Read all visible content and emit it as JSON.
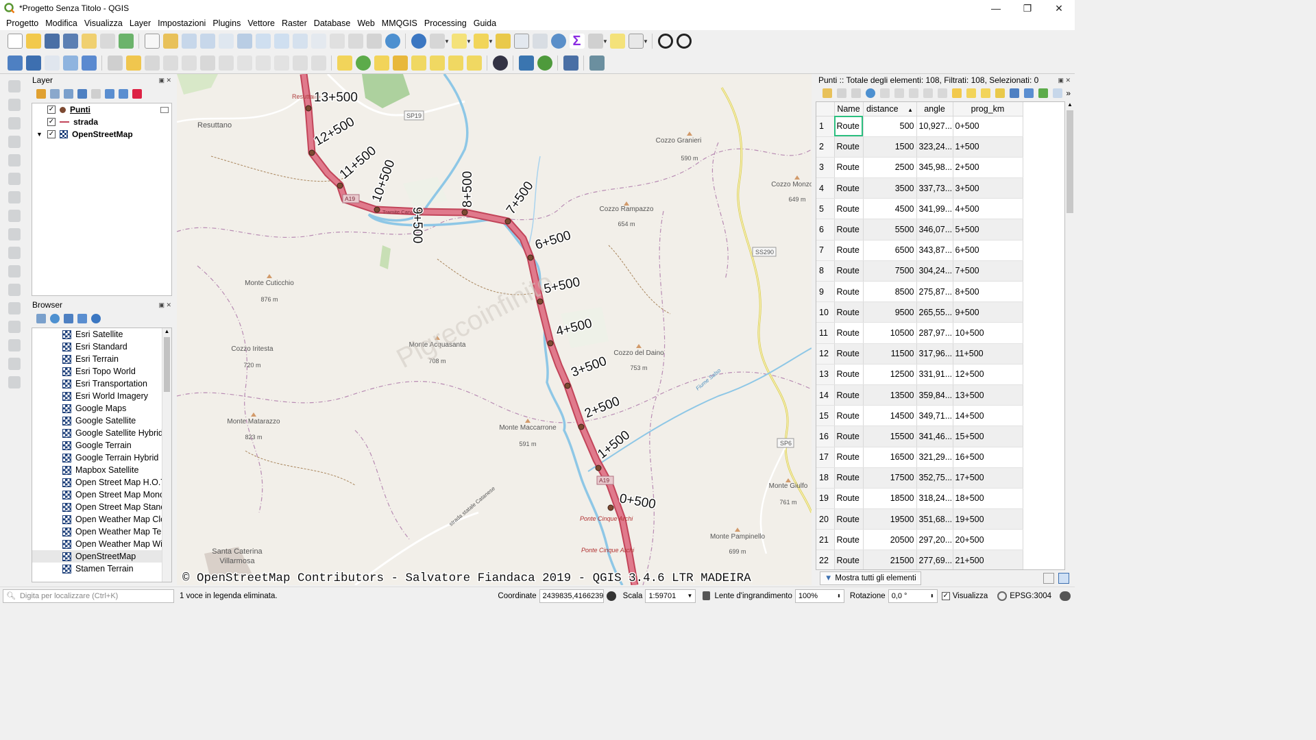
{
  "window": {
    "title": "*Progetto Senza Titolo - QGIS",
    "controls": [
      "—",
      "❐",
      "✕"
    ]
  },
  "menu": [
    "Progetto",
    "Modifica",
    "Visualizza",
    "Layer",
    "Impostazioni",
    "Plugins",
    "Vettore",
    "Raster",
    "Database",
    "Web",
    "MMQGIS",
    "Processing",
    "Guida"
  ],
  "layers_panel": {
    "title": "Layer",
    "items": [
      {
        "name": "Punti",
        "checked": "✓"
      },
      {
        "name": "strada",
        "checked": "✓"
      },
      {
        "name": "OpenStreetMap",
        "checked": "✓"
      }
    ]
  },
  "browser_panel": {
    "title": "Browser",
    "items": [
      "Esri Satellite",
      "Esri Standard",
      "Esri Terrain",
      "Esri Topo World",
      "Esri Transportation",
      "Esri World Imagery",
      "Google Maps",
      "Google Satellite",
      "Google Satellite Hybrid",
      "Google Terrain",
      "Google Terrain Hybrid",
      "Mapbox Satellite",
      "Open Street Map H.O.T.",
      "Open Street Map Mono",
      "Open Street Map Stand",
      "Open Weather Map Clo",
      "Open Weather Map Ten",
      "Open Weather Map Wir",
      "OpenStreetMap",
      "Stamen Terrain"
    ],
    "selected": "OpenStreetMap"
  },
  "map": {
    "attribution": "© OpenStreetMap Contributors - Salvatore Fiandaca 2019 - QGIS 3.4.6 LTR MADEIRA",
    "watermark": "Pigrecoinfinito",
    "chainage_labels": [
      "13+500",
      "12+500",
      "11+500",
      "10+500",
      "9+500",
      "8+500",
      "7+500",
      "6+500",
      "5+500",
      "4+500",
      "3+500",
      "2+500",
      "1+500",
      "0+500"
    ],
    "place_labels": [
      "Resuttano",
      "Resuttano",
      "SP19",
      "Cozzo Granieri",
      "590 m",
      "Cozzo Monzonar",
      "649 m",
      "Cozzo Rampazzo",
      "654 m",
      "SS290",
      "Monte Cuticchio",
      "876 m",
      "Monte Acquasanta",
      "708 m",
      "Cozzo Iritesta",
      "720 m",
      "Cozzo del Daino",
      "753 m",
      "Monte Matarazzo",
      "823 m",
      "Monte Maccarrone",
      "591 m",
      "SP6",
      "Monte Giulfo",
      "761 m",
      "A19",
      "A19",
      "Ponte Cinque Archi",
      "Ponte Cinque Archi",
      "Santa Caterina",
      "Villarmosa",
      "Monte Pampinello",
      "699 m",
      "Fiume Salso",
      "strada statale Catanese",
      "Tramite Canarese"
    ]
  },
  "attr_table": {
    "title": "Punti :: Totale degli elementi: 108, Filtrati: 108, Selezionati: 0",
    "columns": [
      "Name",
      "distance",
      "angle",
      "prog_km"
    ],
    "sort_indicator": "▲",
    "rows": [
      [
        "1",
        "Route",
        "500",
        "10,927...",
        "0+500"
      ],
      [
        "2",
        "Route",
        "1500",
        "323,24...",
        "1+500"
      ],
      [
        "3",
        "Route",
        "2500",
        "345,98...",
        "2+500"
      ],
      [
        "4",
        "Route",
        "3500",
        "337,73...",
        "3+500"
      ],
      [
        "5",
        "Route",
        "4500",
        "341,99...",
        "4+500"
      ],
      [
        "6",
        "Route",
        "5500",
        "346,07...",
        "5+500"
      ],
      [
        "7",
        "Route",
        "6500",
        "343,87...",
        "6+500"
      ],
      [
        "8",
        "Route",
        "7500",
        "304,24...",
        "7+500"
      ],
      [
        "9",
        "Route",
        "8500",
        "275,87...",
        "8+500"
      ],
      [
        "10",
        "Route",
        "9500",
        "265,55...",
        "9+500"
      ],
      [
        "11",
        "Route",
        "10500",
        "287,97...",
        "10+500"
      ],
      [
        "12",
        "Route",
        "11500",
        "317,96...",
        "11+500"
      ],
      [
        "13",
        "Route",
        "12500",
        "331,91...",
        "12+500"
      ],
      [
        "14",
        "Route",
        "13500",
        "359,84...",
        "13+500"
      ],
      [
        "15",
        "Route",
        "14500",
        "349,71...",
        "14+500"
      ],
      [
        "16",
        "Route",
        "15500",
        "341,46...",
        "15+500"
      ],
      [
        "17",
        "Route",
        "16500",
        "321,29...",
        "16+500"
      ],
      [
        "18",
        "Route",
        "17500",
        "352,75...",
        "17+500"
      ],
      [
        "19",
        "Route",
        "18500",
        "318,24...",
        "18+500"
      ],
      [
        "20",
        "Route",
        "19500",
        "351,68...",
        "19+500"
      ],
      [
        "21",
        "Route",
        "20500",
        "297,20...",
        "20+500"
      ],
      [
        "22",
        "Route",
        "21500",
        "277,69...",
        "21+500"
      ]
    ],
    "show_all_button": "Mostra tutti gli elementi"
  },
  "status": {
    "locator_placeholder": "Digita per localizzare (Ctrl+K)",
    "message": "1 voce in legenda eliminata.",
    "coord_label": "Coordinate",
    "coord_value": "2439835,4166239",
    "scale_label": "Scala",
    "scale_value": "1:59701",
    "magnifier_label": "Lente d'ingrandimento",
    "magnifier_value": "100%",
    "rotation_label": "Rotazione",
    "rotation_value": "0,0 °",
    "render_label": "Visualizza",
    "render_check": "✓",
    "crs": "EPSG:3004"
  },
  "colors": {
    "route_fill": "#e07a8c",
    "route_edge": "#c2455a",
    "point": "#7d4a32",
    "river": "#8ec7e6",
    "boundary": "#b88bb3",
    "qgis_green": "#589632"
  }
}
